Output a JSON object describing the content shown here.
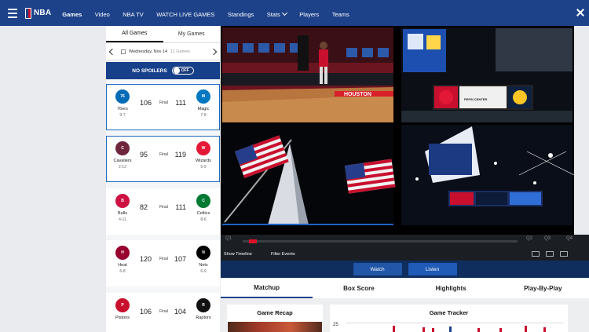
{
  "nav": {
    "brand": "NBA",
    "items": [
      {
        "label": "Games",
        "active": true
      },
      {
        "label": "Video"
      },
      {
        "label": "NBA TV"
      },
      {
        "label": "WATCH LIVE GAMES"
      },
      {
        "label": "Standings"
      },
      {
        "label": "Stats",
        "dropdown": true
      },
      {
        "label": "Players"
      },
      {
        "label": "Teams"
      }
    ]
  },
  "sidebar": {
    "tabs": [
      "All Games",
      "My Games"
    ],
    "date": "Wednesday, Nov 14",
    "games_count": "11 Games",
    "no_spoilers": "NO SPOILERS",
    "toggle": "OFF",
    "final_label": "Final",
    "games": [
      {
        "away": {
          "name": "76ers",
          "record": "9-7",
          "score": "106",
          "color": "#006bb6"
        },
        "home": {
          "name": "Magic",
          "record": "7-8",
          "score": "111",
          "color": "#0077c0"
        }
      },
      {
        "away": {
          "name": "Cavaliers",
          "record": "2-12",
          "score": "95",
          "color": "#6f263d"
        },
        "home": {
          "name": "Wizards",
          "record": "5-9",
          "score": "119",
          "color": "#e31837"
        }
      },
      {
        "away": {
          "name": "Bulls",
          "record": "4-11",
          "score": "82",
          "color": "#ce1141"
        },
        "home": {
          "name": "Celtics",
          "record": "8-6",
          "score": "111",
          "color": "#007a33"
        }
      },
      {
        "away": {
          "name": "Heat",
          "record": "6-8",
          "score": "120",
          "color": "#98002e"
        },
        "home": {
          "name": "Nets",
          "record": "6-9",
          "score": "107",
          "color": "#000000"
        }
      },
      {
        "away": {
          "name": "Pistons",
          "record": "",
          "score": "106",
          "color": "#c8102e"
        },
        "home": {
          "name": "Raptors",
          "record": "",
          "score": "104",
          "color": "#111111"
        }
      }
    ]
  },
  "player": {
    "quarters": [
      "Q1",
      "Q2",
      "Q3",
      "Q4"
    ],
    "show_timeline": "Show Timeline",
    "filter_events": "Filter Events",
    "watch": "Watch",
    "listen": "Listen",
    "court_text": "HOUSTON",
    "scoreboard_text": "PEPSI CENTER"
  },
  "detail_tabs": [
    "Matchup",
    "Box Score",
    "Highlights",
    "Play-By-Play"
  ],
  "panels": {
    "recap": "Game Recap",
    "tracker": "Game Tracker",
    "tracker_tick": "25"
  },
  "colors": {
    "nav_bg": "#1d428a",
    "accent_red": "#e0112a",
    "selected_border": "#1d6ac3"
  }
}
